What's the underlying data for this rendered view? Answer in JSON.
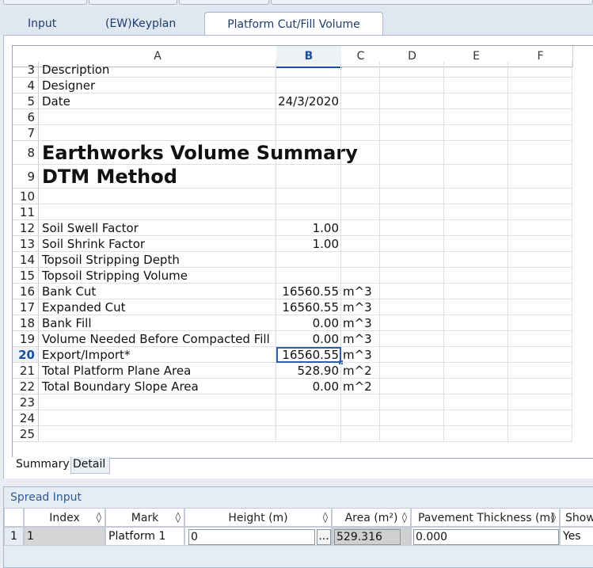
{
  "tabs": [
    {
      "label": "Input"
    },
    {
      "label": "(EW)Keyplan"
    },
    {
      "label": "Platform Cut/Fill Volume"
    }
  ],
  "columns": [
    "A",
    "B",
    "C",
    "D",
    "E",
    "F"
  ],
  "rows": [
    {
      "num": "3",
      "a": "Description",
      "b": "",
      "c": ""
    },
    {
      "num": "4",
      "a": "Designer",
      "b": "",
      "c": ""
    },
    {
      "num": "5",
      "a": "Date",
      "b": "24/3/2020",
      "c": ""
    },
    {
      "num": "6",
      "a": "",
      "b": "",
      "c": ""
    },
    {
      "num": "7",
      "a": "",
      "b": "",
      "c": ""
    },
    {
      "num": "8",
      "a": "Earthworks Volume Summary",
      "b": "",
      "c": ""
    },
    {
      "num": "9",
      "a": "DTM Method",
      "b": "",
      "c": ""
    },
    {
      "num": "10",
      "a": "",
      "b": "",
      "c": ""
    },
    {
      "num": "11",
      "a": "",
      "b": "",
      "c": ""
    },
    {
      "num": "12",
      "a": "Soil Swell Factor",
      "b": "1.00",
      "c": ""
    },
    {
      "num": "13",
      "a": "Soil Shrink Factor",
      "b": "1.00",
      "c": ""
    },
    {
      "num": "14",
      "a": "Topsoil Stripping Depth",
      "b": "",
      "c": ""
    },
    {
      "num": "15",
      "a": "Topsoil Stripping Volume",
      "b": "",
      "c": ""
    },
    {
      "num": "16",
      "a": "Bank Cut",
      "b": "16560.55",
      "c": "m^3"
    },
    {
      "num": "17",
      "a": "Expanded Cut",
      "b": "16560.55",
      "c": "m^3"
    },
    {
      "num": "18",
      "a": "Bank Fill",
      "b": "0.00",
      "c": "m^3"
    },
    {
      "num": "19",
      "a": "Volume Needed Before Compacted Fill",
      "b": "0.00",
      "c": "m^3"
    },
    {
      "num": "20",
      "a": "Export/Import*",
      "b": "16560.55",
      "c": "m^3"
    },
    {
      "num": "21",
      "a": "Total Platform Plane Area",
      "b": "528.90",
      "c": "m^2"
    },
    {
      "num": "22",
      "a": "Total Boundary Slope Area",
      "b": "0.00",
      "c": "m^2"
    },
    {
      "num": "23",
      "a": "",
      "b": "",
      "c": ""
    },
    {
      "num": "24",
      "a": "",
      "b": "",
      "c": ""
    },
    {
      "num": "25",
      "a": "",
      "b": "",
      "c": ""
    }
  ],
  "sheet_tabs": [
    "Summary",
    "Detail"
  ],
  "spread": {
    "title": "Spread Input",
    "headers": [
      "Index",
      "Mark",
      "Height (m)",
      "Area (m²)",
      "Pavement Thickness (m)",
      "Show"
    ],
    "sort_glyph": "◊",
    "row": {
      "num": "1",
      "index": "1",
      "mark": "Platform 1",
      "height": "0",
      "ellipsis": "...",
      "area": "529.316",
      "pavement": "0.000",
      "show": "Yes"
    }
  }
}
